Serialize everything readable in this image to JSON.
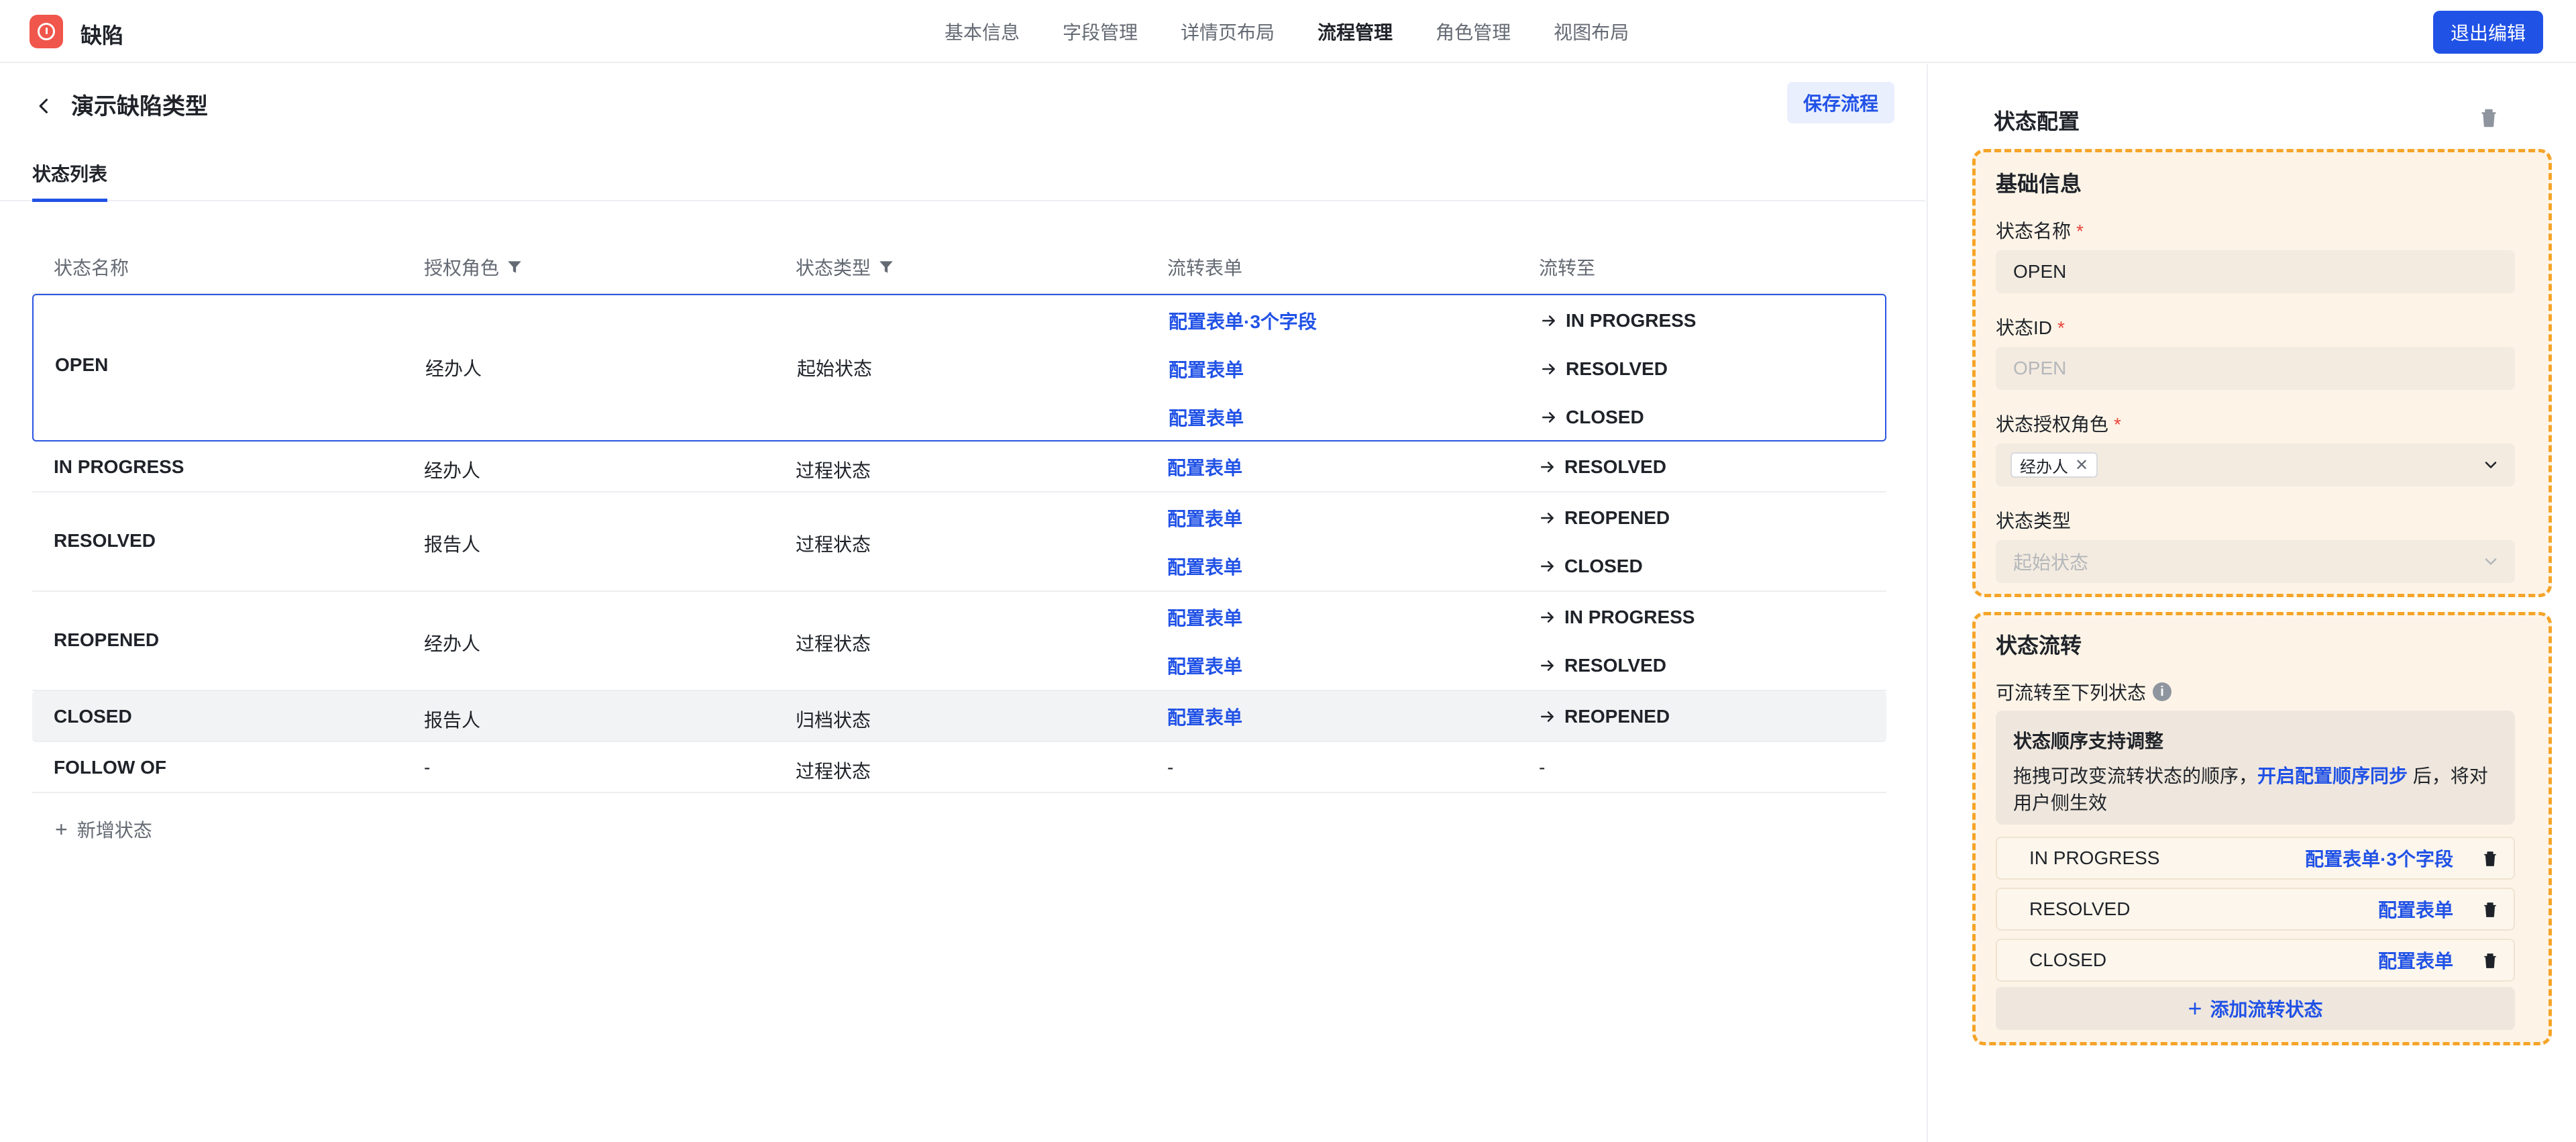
{
  "app": {
    "title": "缺陷"
  },
  "nav": {
    "items": [
      "基本信息",
      "字段管理",
      "详情页布局",
      "流程管理",
      "角色管理",
      "视图布局"
    ],
    "active": "流程管理"
  },
  "header": {
    "exit_label": "退出编辑"
  },
  "page": {
    "title": "演示缺陷类型",
    "save_label": "保存流程"
  },
  "tabs": {
    "state_list": "状态列表"
  },
  "table": {
    "headers": [
      "状态名称",
      "授权角色",
      "状态类型",
      "流转表单",
      "流转至"
    ],
    "rows": [
      {
        "name": "OPEN",
        "role": "经办人",
        "type": "起始状态",
        "transitions": [
          {
            "form": "配置表单·3个字段",
            "to": "IN PROGRESS"
          },
          {
            "form": "配置表单",
            "to": "RESOLVED"
          },
          {
            "form": "配置表单",
            "to": "CLOSED"
          }
        ]
      },
      {
        "name": "IN PROGRESS",
        "role": "经办人",
        "type": "过程状态",
        "transitions": [
          {
            "form": "配置表单",
            "to": "RESOLVED"
          }
        ]
      },
      {
        "name": "RESOLVED",
        "role": "报告人",
        "type": "过程状态",
        "transitions": [
          {
            "form": "配置表单",
            "to": "REOPENED"
          },
          {
            "form": "配置表单",
            "to": "CLOSED"
          }
        ]
      },
      {
        "name": "REOPENED",
        "role": "经办人",
        "type": "过程状态",
        "transitions": [
          {
            "form": "配置表单",
            "to": "IN PROGRESS"
          },
          {
            "form": "配置表单",
            "to": "RESOLVED"
          }
        ]
      },
      {
        "name": "CLOSED",
        "role": "报告人",
        "type": "归档状态",
        "transitions": [
          {
            "form": "配置表单",
            "to": "REOPENED"
          }
        ]
      },
      {
        "name": "FOLLOW OF",
        "role": "-",
        "type": "过程状态",
        "empty_form": "-",
        "empty_to": "-"
      }
    ],
    "add_label": "新增状态"
  },
  "side": {
    "title": "状态配置",
    "basic": {
      "title": "基础信息",
      "name_label": "状态名称",
      "name_value": "OPEN",
      "id_label": "状态ID",
      "id_value": "OPEN",
      "role_label": "状态授权角色",
      "role_chip": "经办人",
      "type_label": "状态类型",
      "type_value": "起始状态",
      "required_mark": "*"
    },
    "flow": {
      "title": "状态流转",
      "sub_label": "可流转至下列状态",
      "notice_title": "状态顺序支持调整",
      "notice_text_1": "拖拽可改变流转状态的顺序，",
      "notice_link": "开启配置顺序同步",
      "notice_text_2": " 后，将对用户侧生效",
      "items": [
        {
          "name": "IN PROGRESS",
          "link": "配置表单·3个字段"
        },
        {
          "name": "RESOLVED",
          "link": "配置表单"
        },
        {
          "name": "CLOSED",
          "link": "配置表单"
        }
      ],
      "add_label": "添加流转状态"
    }
  },
  "colors": {
    "accent": "#2152e6",
    "highlight_border": "#f5a428",
    "danger": "#e8433a",
    "logo": "#f0564b"
  }
}
